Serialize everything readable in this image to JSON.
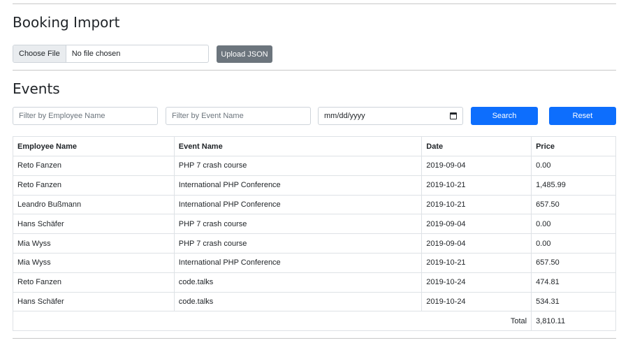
{
  "import_section": {
    "title": "Booking Import",
    "file_input": {
      "choose_label": "Choose File",
      "status": "No file chosen"
    },
    "upload_button": "Upload JSON"
  },
  "events_section": {
    "title": "Events",
    "filters": {
      "employee_placeholder": "Filter by Employee Name",
      "event_placeholder": "Filter by Event Name",
      "date_placeholder": "mm/dd/yyyy",
      "search_button": "Search",
      "reset_button": "Reset"
    },
    "table": {
      "headers": [
        "Employee Name",
        "Event Name",
        "Date",
        "Price"
      ],
      "rows": [
        [
          "Reto Fanzen",
          "PHP 7 crash course",
          "2019-09-04",
          "0.00"
        ],
        [
          "Reto Fanzen",
          "International PHP Conference",
          "2019-10-21",
          "1,485.99"
        ],
        [
          "Leandro Bußmann",
          "International PHP Conference",
          "2019-10-21",
          "657.50"
        ],
        [
          "Hans Schäfer",
          "PHP 7 crash course",
          "2019-09-04",
          "0.00"
        ],
        [
          "Mia Wyss",
          "PHP 7 crash course",
          "2019-09-04",
          "0.00"
        ],
        [
          "Mia Wyss",
          "International PHP Conference",
          "2019-10-21",
          "657.50"
        ],
        [
          "Reto Fanzen",
          "code.talks",
          "2019-10-24",
          "474.81"
        ],
        [
          "Hans Schäfer",
          "code.talks",
          "2019-10-24",
          "534.31"
        ]
      ],
      "total_label": "Total",
      "total_value": "3,810.11"
    }
  },
  "colors": {
    "primary": "#0d6efd",
    "secondary": "#6c757d",
    "border": "#dee2e6"
  }
}
